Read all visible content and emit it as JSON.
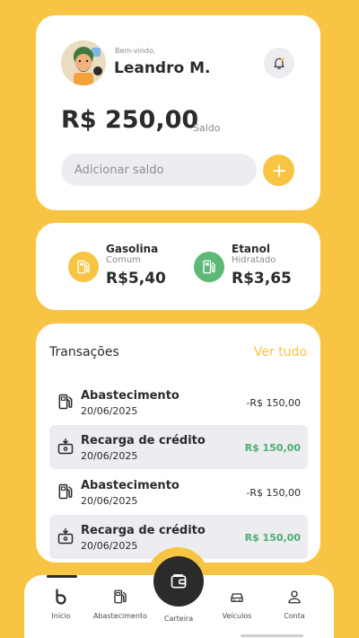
{
  "header": {
    "welcome": "Bem-vindo,",
    "username": "Leandro M.",
    "balance": "R$ 250,00",
    "balance_label": "Saldo",
    "add_placeholder": "Adicionar saldo"
  },
  "fuel": [
    {
      "name": "Gasolina",
      "type": "Comum",
      "price": "R$5,40",
      "color": "#F8C443",
      "icon": "fuel-pump-icon"
    },
    {
      "name": "Etanol",
      "type": "Hidratado",
      "price": "R$3,65",
      "color": "#5DB975",
      "icon": "fuel-pump-icon"
    }
  ],
  "transactions": {
    "title": "Transações",
    "see_all": "Ver tudo",
    "items": [
      {
        "name": "Abastecimento",
        "date": "20/06/2025",
        "amount": "-R$ 150,00",
        "kind": "debit",
        "icon": "fuel-pump-icon"
      },
      {
        "name": "Recarga de crédito",
        "date": "20/06/2025",
        "amount": "R$ 150,00",
        "kind": "credit",
        "icon": "deposit-icon"
      },
      {
        "name": "Abastecimento",
        "date": "20/06/2025",
        "amount": "-R$ 150,00",
        "kind": "debit",
        "icon": "fuel-pump-icon"
      },
      {
        "name": "Recarga de crédito",
        "date": "20/06/2025",
        "amount": "R$ 150,00",
        "kind": "credit",
        "icon": "deposit-icon"
      }
    ]
  },
  "nav": {
    "items": [
      {
        "label": "Início",
        "icon": "home-logo-icon"
      },
      {
        "label": "Abastecimento",
        "icon": "fuel-pump-icon"
      },
      {
        "label": "Carteira",
        "icon": "wallet-icon"
      },
      {
        "label": "Veículos",
        "icon": "car-icon"
      },
      {
        "label": "Conta",
        "icon": "user-icon"
      }
    ]
  },
  "colors": {
    "accent": "#F8C443",
    "credit": "#4CAF6E",
    "dark": "#2B2B2B"
  }
}
